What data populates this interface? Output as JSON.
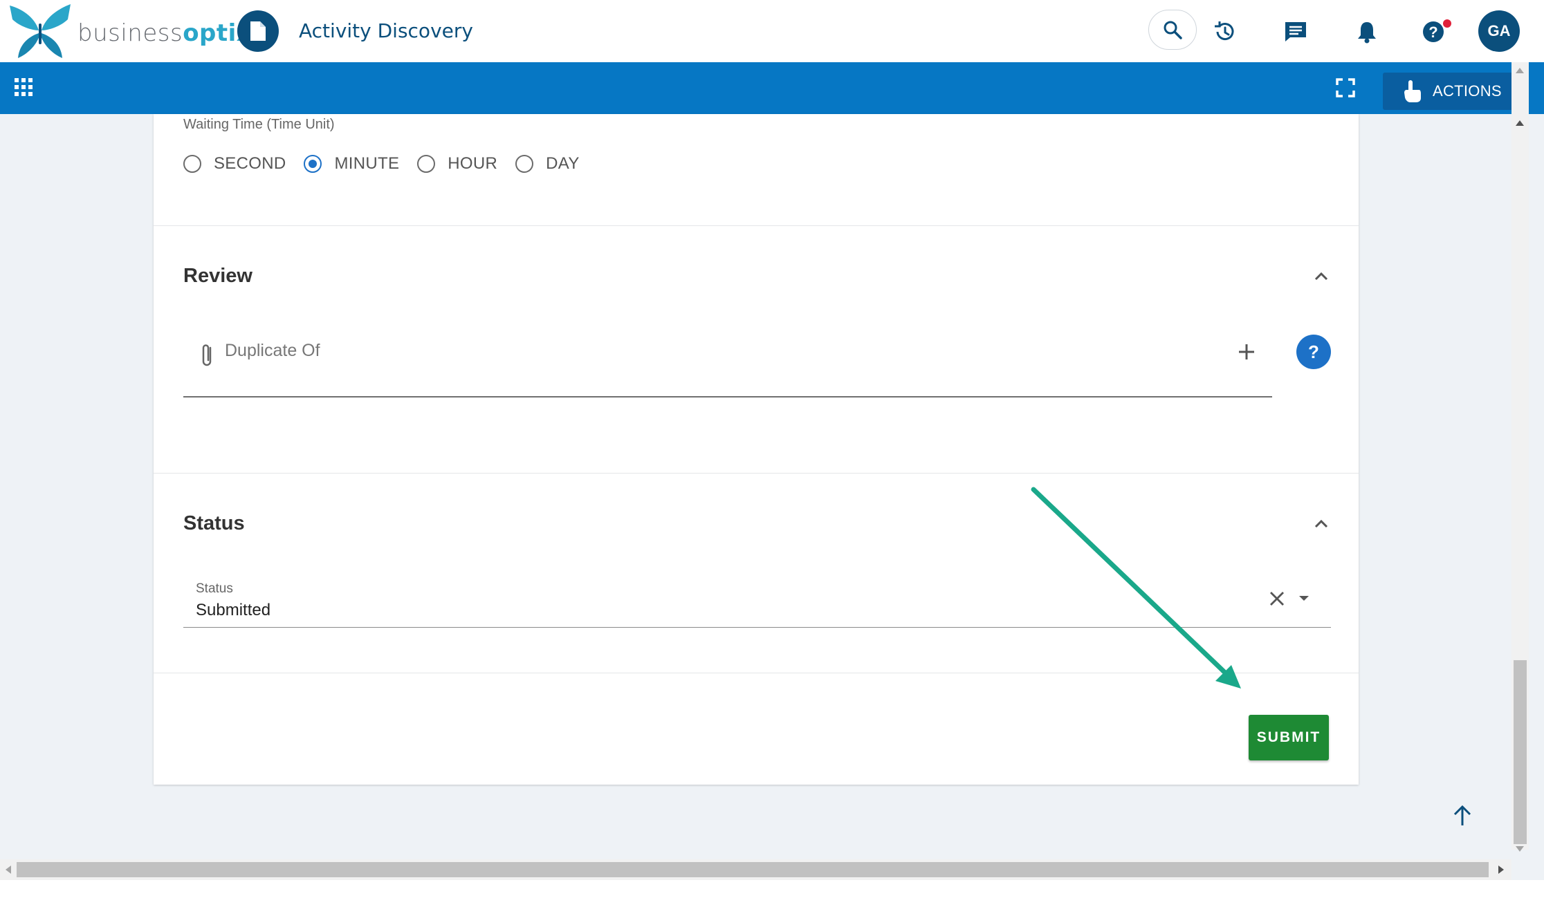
{
  "header": {
    "logo_text_part1": "business",
    "logo_text_part2": "optix",
    "page_title": "Activity Discovery",
    "user_initials": "GA"
  },
  "nav": {
    "actions_label": "ACTIONS"
  },
  "form": {
    "waiting_time": {
      "label": "Waiting Time (Time Unit)",
      "options": [
        "SECOND",
        "MINUTE",
        "HOUR",
        "DAY"
      ],
      "selected": "MINUTE"
    },
    "review": {
      "title": "Review",
      "duplicate_label": "Duplicate Of",
      "help_glyph": "?"
    },
    "status": {
      "title": "Status",
      "field_label": "Status",
      "value": "Submitted"
    },
    "submit_label": "SUBMIT"
  },
  "colors": {
    "brand_dark": "#0b4f7c",
    "nav_blue": "#0677c4",
    "accent_blue": "#1d71c7",
    "submit_green": "#1e8a34",
    "annotation_arrow": "#1aa88a"
  }
}
